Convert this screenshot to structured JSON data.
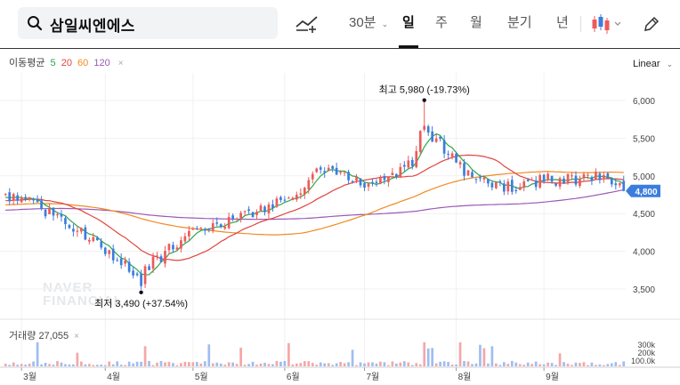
{
  "search": {
    "query": "삼일씨엔에스"
  },
  "toolbar": {
    "periods": [
      "30분",
      "일",
      "주",
      "월",
      "분기",
      "년"
    ],
    "active_period": "일"
  },
  "chart_meta": {
    "ma_title": "이동평균",
    "ma_periods": [
      "5",
      "20",
      "60",
      "120"
    ],
    "ma_colors": [
      "#2aa84a",
      "#e0443e",
      "#f08a24",
      "#9b59b6"
    ],
    "scale": "Linear",
    "volume_title": "거래량",
    "volume_value": "27,055",
    "current_price": "4,800",
    "high_label": "최고",
    "high_text": "5,980 (-19.73%)",
    "low_label": "최저",
    "low_text": "3,490 (+37.54%)",
    "watermark": [
      "NAVER",
      "FINANCIAL"
    ],
    "up_color": "#ec5b5b",
    "down_color": "#3b7ddd"
  },
  "chart_data": {
    "type": "candlestick",
    "y_ticks": [
      "6,000",
      "5,500",
      "5,000",
      "4,500",
      "4,000",
      "3,500"
    ],
    "ylim": [
      3200,
      6200
    ],
    "volume_ticks": [
      "300k",
      "200k",
      "100.0k"
    ],
    "x_ticks": [
      "3월",
      "4월",
      "5월",
      "6월",
      "7월",
      "8월",
      "9월"
    ],
    "price_summary": {
      "high": 5980,
      "low": 3490,
      "last": 4800
    },
    "anchors": [
      [
        "03-01",
        4700
      ],
      [
        "03-10",
        4550
      ],
      [
        "03-20",
        4300
      ],
      [
        "03-31",
        4000
      ],
      [
        "04-08",
        3800
      ],
      [
        "04-12",
        3600
      ],
      [
        "04-18",
        3900
      ],
      [
        "04-30",
        4250
      ],
      [
        "05-10",
        4350
      ],
      [
        "05-20",
        4500
      ],
      [
        "05-31",
        4650
      ],
      [
        "06-10",
        4900
      ],
      [
        "06-15",
        5150
      ],
      [
        "06-25",
        5000
      ],
      [
        "07-01",
        4900
      ],
      [
        "07-10",
        5000
      ],
      [
        "07-17",
        5150
      ],
      [
        "07-20",
        5750
      ],
      [
        "07-25",
        5450
      ],
      [
        "07-31",
        5250
      ],
      [
        "08-08",
        4950
      ],
      [
        "08-20",
        4850
      ],
      [
        "08-31",
        4950
      ],
      [
        "09-10",
        4950
      ],
      [
        "09-20",
        5000
      ],
      [
        "09-30",
        4800
      ]
    ]
  }
}
